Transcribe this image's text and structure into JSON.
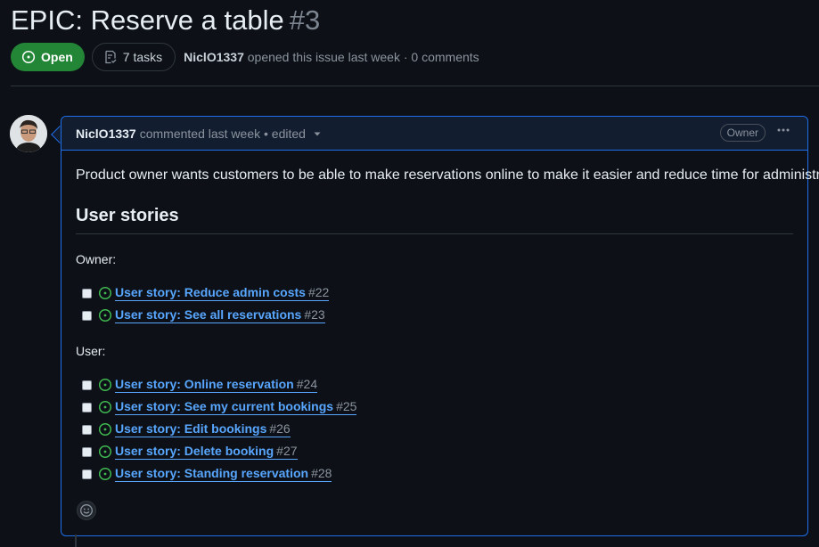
{
  "issue": {
    "title": "EPIC: Reserve a table",
    "number": "#3",
    "state": "Open",
    "tasks": "7 tasks",
    "author": "NiclO1337",
    "meta_rest": "opened this issue last week · 0 comments"
  },
  "comment": {
    "author": "NiclO1337",
    "meta": "commented last week • edited",
    "role_badge": "Owner",
    "description": "Product owner wants customers to be able to make reservations online to make it easier and reduce time for administration.",
    "heading": "User stories",
    "groups": [
      {
        "label": "Owner:",
        "tasks": [
          {
            "title": "User story: Reduce admin costs",
            "num": "#22"
          },
          {
            "title": "User story: See all reservations",
            "num": "#23"
          }
        ]
      },
      {
        "label": "User:",
        "tasks": [
          {
            "title": "User story: Online reservation",
            "num": "#24"
          },
          {
            "title": "User story: See my current bookings",
            "num": "#25"
          },
          {
            "title": "User story: Edit bookings",
            "num": "#26"
          },
          {
            "title": "User story: Delete booking",
            "num": "#27"
          },
          {
            "title": "User story: Standing reservation",
            "num": "#28"
          }
        ]
      }
    ]
  },
  "colors": {
    "open_green": "#238636",
    "link_blue": "#58a6ff",
    "border_blue": "#1f6feb",
    "issue_open_icon": "#3fb950"
  },
  "icons": {
    "state": "issue-opened-icon",
    "tasks": "checklist-icon",
    "task_status": "issue-opened-icon",
    "menu": "kebab-horizontal-icon",
    "reaction": "smiley-icon"
  }
}
